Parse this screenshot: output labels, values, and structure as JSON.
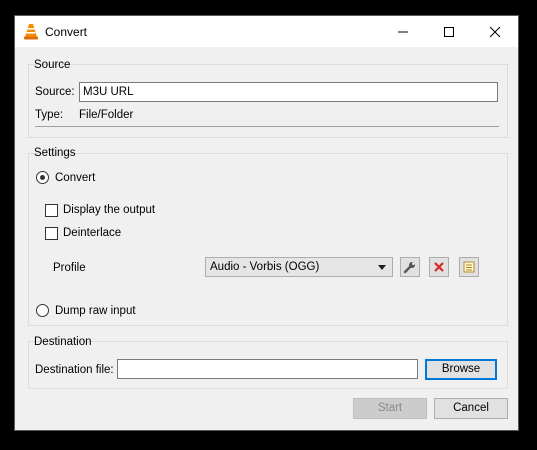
{
  "window": {
    "title": "Convert"
  },
  "source": {
    "section_label": "Source",
    "source_label": "Source:",
    "source_value": "M3U URL",
    "type_label": "Type:",
    "type_value": "File/Folder"
  },
  "settings": {
    "section_label": "Settings",
    "convert_label": "Convert",
    "convert_checked": true,
    "display_output_label": "Display the output",
    "deinterlace_label": "Deinterlace",
    "profile_label": "Profile",
    "profile_selected": "Audio - Vorbis (OGG)",
    "dump_raw_label": "Dump raw input",
    "dump_raw_checked": false
  },
  "destination": {
    "section_label": "Destination",
    "file_label": "Destination file:",
    "file_value": "",
    "browse_label": "Browse"
  },
  "actions": {
    "start_label": "Start",
    "cancel_label": "Cancel"
  },
  "icons": {
    "app": "vlc-cone-icon",
    "minimize": "minimize-icon",
    "maximize": "maximize-icon",
    "close": "close-icon",
    "edit_profile": "wrench-icon",
    "delete_profile": "red-x-icon",
    "new_profile": "new-profile-icon"
  },
  "colors": {
    "accent": "#0078d7",
    "vlc_orange": "#f48b00",
    "delete_red": "#d42a2a"
  }
}
